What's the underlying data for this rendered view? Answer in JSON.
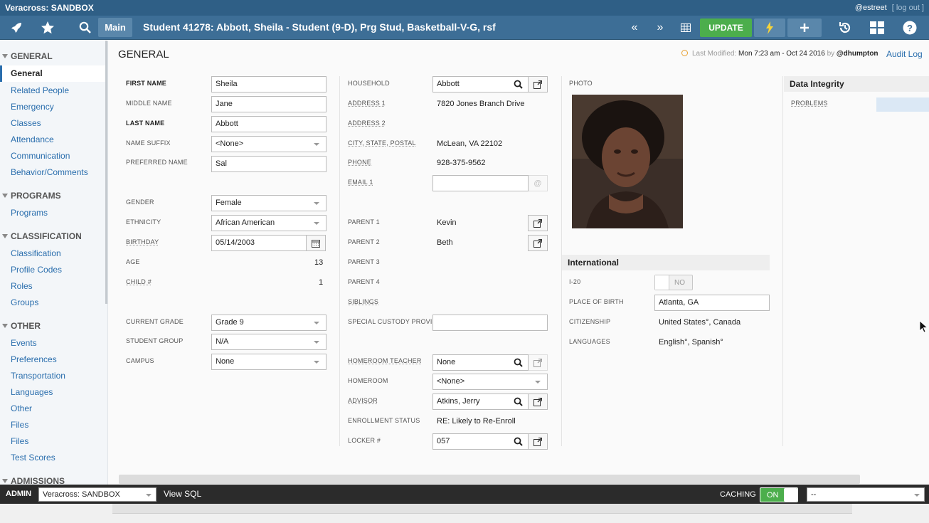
{
  "app": {
    "title": "Veracross: SANDBOX",
    "user": "@estreet",
    "logout": "[ log out ]"
  },
  "nav": {
    "main_tab": "Main",
    "title": "Student 41278: Abbott, Sheila - Student (9-D), Prg Stud, Basketball-V-G, rsf",
    "update": "UPDATE",
    "icons": [
      "rocket-icon",
      "star-icon",
      "search-icon",
      "prev-icon",
      "next-icon",
      "grid-icon",
      "bolt-icon",
      "plus-icon",
      "history-icon",
      "apps-icon",
      "help-icon"
    ]
  },
  "sidebar": {
    "general": {
      "title": "GENERAL",
      "active": "General",
      "items": [
        "Related People",
        "Emergency",
        "Classes",
        "Attendance",
        "Communication",
        "Behavior/Comments"
      ]
    },
    "programs": {
      "title": "PROGRAMS",
      "items": [
        "Programs"
      ]
    },
    "classification": {
      "title": "CLASSIFICATION",
      "items": [
        "Classification",
        "Profile Codes",
        "Roles",
        "Groups"
      ]
    },
    "other": {
      "title": "OTHER",
      "items": [
        "Events",
        "Preferences",
        "Transportation",
        "Languages",
        "Other",
        "Files",
        "Files",
        "Test Scores"
      ]
    },
    "admissions": {
      "title": "ADMISSIONS"
    }
  },
  "header": {
    "page_title": "GENERAL",
    "last_modified_label": "Last Modified:",
    "last_modified_value": "Mon 7:23 am - Oct 24 2016",
    "by": "by",
    "by_user": "@dhumpton",
    "audit_log": "Audit Log"
  },
  "col1": {
    "first_name": {
      "label": "FIRST NAME",
      "value": "Sheila"
    },
    "middle_name": {
      "label": "MIDDLE NAME",
      "value": "Jane"
    },
    "last_name": {
      "label": "LAST NAME",
      "value": "Abbott"
    },
    "name_suffix": {
      "label": "NAME SUFFIX",
      "value": "<None>"
    },
    "preferred_name": {
      "label": "PREFERRED NAME",
      "value": "Sal"
    },
    "gender": {
      "label": "GENDER",
      "value": "Female"
    },
    "ethnicity": {
      "label": "ETHNICITY",
      "value": "African American"
    },
    "birthday": {
      "label": "BIRTHDAY",
      "value": "05/14/2003"
    },
    "age": {
      "label": "AGE",
      "value": "13"
    },
    "child": {
      "label": "CHILD #",
      "value": "1"
    },
    "current_grade": {
      "label": "CURRENT GRADE",
      "value": "Grade 9"
    },
    "student_group": {
      "label": "STUDENT GROUP",
      "value": "N/A"
    },
    "campus": {
      "label": "CAMPUS",
      "value": "None"
    }
  },
  "col2": {
    "household": {
      "label": "HOUSEHOLD",
      "value": "Abbott"
    },
    "address1": {
      "label": "ADDRESS 1",
      "value": "7820 Jones Branch Drive"
    },
    "address2": {
      "label": "ADDRESS 2",
      "value": ""
    },
    "city": {
      "label": "CITY, STATE, POSTAL",
      "value": "McLean, VA 22102"
    },
    "phone": {
      "label": "PHONE",
      "value": "928-375-9562"
    },
    "email1": {
      "label": "EMAIL 1",
      "value": ""
    },
    "parent1": {
      "label": "PARENT 1",
      "value": "Kevin"
    },
    "parent2": {
      "label": "PARENT 2",
      "value": "Beth"
    },
    "parent3": {
      "label": "PARENT 3"
    },
    "parent4": {
      "label": "PARENT 4"
    },
    "siblings": {
      "label": "SIBLINGS"
    },
    "custody": {
      "label": "SPECIAL CUSTODY PROVI...",
      "value": ""
    },
    "homeroom_teacher": {
      "label": "HOMEROOM TEACHER",
      "value": "None"
    },
    "homeroom": {
      "label": "HOMEROOM",
      "value": "<None>"
    },
    "advisor": {
      "label": "ADVISOR",
      "value": "Atkins, Jerry"
    },
    "enrollment_status": {
      "label": "ENROLLMENT STATUS",
      "value": "RE: Likely to Re-Enroll"
    },
    "locker": {
      "label": "LOCKER #",
      "value": "057"
    }
  },
  "col3": {
    "photo_label": "PHOTO",
    "international": "International",
    "i20": {
      "label": "I-20",
      "value": "NO"
    },
    "place_of_birth": {
      "label": "PLACE OF BIRTH",
      "value": "Atlanta, GA"
    },
    "citizenship": {
      "label": "CITIZENSHIP",
      "value": "United States°, Canada"
    },
    "languages": {
      "label": "LANGUAGES",
      "value": "English°, Spanish°"
    }
  },
  "integrity": {
    "title": "Data Integrity",
    "problems": "PROBLEMS"
  },
  "footer": {
    "admin": "ADMIN",
    "env": "Veracross: SANDBOX",
    "view_sql": "View SQL",
    "caching": "CACHING",
    "caching_state": "ON",
    "right_select": "--"
  },
  "colors": {
    "navbar": "#3d6e96",
    "titlebar": "#2f5f86",
    "accent": "#2a6ead",
    "update": "#4cae4c"
  }
}
